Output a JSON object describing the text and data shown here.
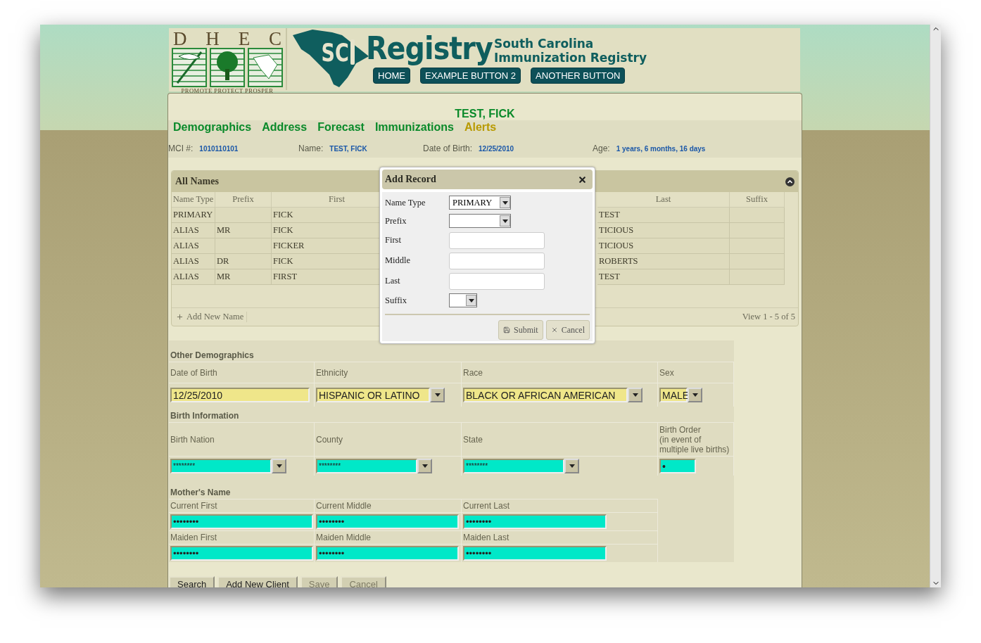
{
  "header": {
    "logo_letters": [
      "D",
      "H",
      "E",
      "C"
    ],
    "logo_tagline": "PROMOTE PROTECT PROSPER",
    "emblem_text": "SC",
    "brand": "Registry",
    "brand_subtitle": [
      "South Carolina",
      "Immunization Registry"
    ],
    "nav_buttons": [
      "HOME",
      "EXAMPLE BUTTON 2",
      "ANOTHER BUTTON"
    ]
  },
  "patient_title": "TEST, FICK",
  "tabs": [
    {
      "label": "Demographics",
      "alert": false
    },
    {
      "label": "Address",
      "alert": false
    },
    {
      "label": "Forecast",
      "alert": false
    },
    {
      "label": "Immunizations",
      "alert": false
    },
    {
      "label": "Alerts",
      "alert": true
    }
  ],
  "info": [
    {
      "label": "MCI #:",
      "value": "1010110101"
    },
    {
      "label": "Name:",
      "value": "TEST, FICK"
    },
    {
      "label": "Date of Birth:",
      "value": "12/25/2010"
    },
    {
      "label": "Age:",
      "value": "1 years, 6 months, 16 days"
    }
  ],
  "all_names": {
    "title": "All Names",
    "columns": [
      "Name Type",
      "Prefix",
      "First",
      "Last",
      "Suffix"
    ],
    "rows": [
      [
        "PRIMARY",
        "",
        "FICK",
        "TEST",
        ""
      ],
      [
        "ALIAS",
        "MR",
        "FICK",
        "TICIOUS",
        ""
      ],
      [
        "ALIAS",
        "",
        "FICKER",
        "TICIOUS",
        ""
      ],
      [
        "ALIAS",
        "DR",
        "FICK",
        "ROBERTS",
        ""
      ],
      [
        "ALIAS",
        "MR",
        "FIRST",
        "TEST",
        ""
      ]
    ],
    "add_link": "Add New Name",
    "pager": "View 1 - 5 of 5"
  },
  "modal": {
    "title": "Add Record",
    "fields": [
      {
        "label": "Name Type",
        "kind": "select",
        "value": "PRIMARY"
      },
      {
        "label": "Prefix",
        "kind": "select"
      },
      {
        "label": "First",
        "kind": "text"
      },
      {
        "label": "Middle",
        "kind": "text"
      },
      {
        "label": "Last",
        "kind": "text"
      },
      {
        "label": "Suffix",
        "kind": "select"
      }
    ],
    "buttons": [
      {
        "label": "Submit",
        "kind": "submit"
      },
      {
        "label": "Cancel",
        "kind": "cancel"
      }
    ]
  },
  "other_demographics": {
    "title": "Other Demographics",
    "fields": [
      {
        "label": "Date of Birth",
        "kind": "text",
        "value": "12/25/2010"
      },
      {
        "label": "Ethnicity",
        "kind": "select",
        "value": "HISPANIC OR LATINO"
      },
      {
        "label": "Race",
        "kind": "select",
        "value": "BLACK OR AFRICAN AMERICAN"
      },
      {
        "label": "Sex",
        "kind": "select",
        "value": "MALE"
      }
    ]
  },
  "birth_information": {
    "title": "Birth Information",
    "fields": [
      {
        "label": "Birth Nation",
        "kind": "select",
        "value": "********"
      },
      {
        "label": "County",
        "kind": "select",
        "value": "********"
      },
      {
        "label": "State",
        "kind": "select",
        "value": "********"
      },
      {
        "label": "Birth Order",
        "note": "(in event of multiple live births)",
        "kind": "small",
        "value": "•"
      }
    ]
  },
  "mothers_name": {
    "title": "Mother's Name",
    "rows": [
      [
        {
          "label": "Current First",
          "value": "••••••••"
        },
        {
          "label": "Current Middle",
          "value": "••••••••"
        },
        {
          "label": "Current Last",
          "value": "••••••••"
        }
      ],
      [
        {
          "label": "Maiden First",
          "value": "••••••••"
        },
        {
          "label": "Maiden Middle",
          "value": "••••••••"
        },
        {
          "label": "Maiden Last",
          "value": "••••••••"
        }
      ]
    ]
  },
  "action_buttons": [
    {
      "label": "Search",
      "disabled": false
    },
    {
      "label": "Add New Client",
      "disabled": false
    },
    {
      "label": "Save",
      "disabled": true
    },
    {
      "label": "Cancel",
      "disabled": true
    }
  ]
}
